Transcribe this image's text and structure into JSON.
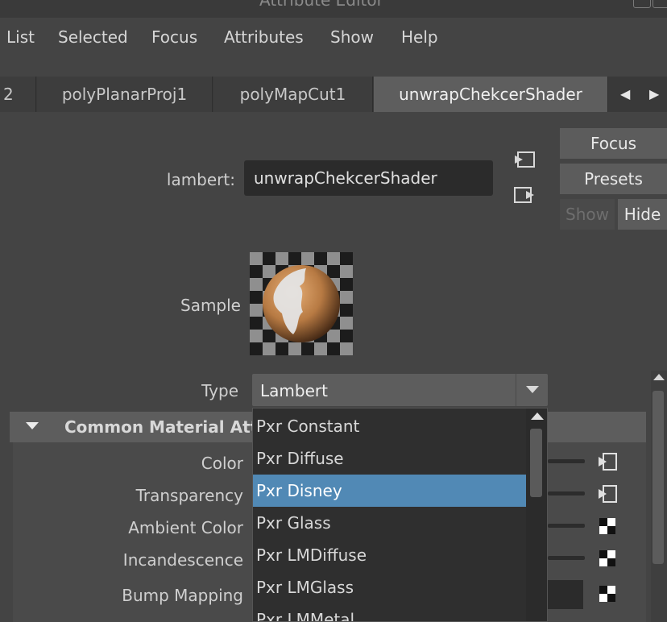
{
  "window": {
    "title_partial": "Attribute Editor"
  },
  "menu": [
    "List",
    "Selected",
    "Focus",
    "Attributes",
    "Show",
    "Help"
  ],
  "tabs": [
    {
      "label": "2",
      "active": false
    },
    {
      "label": "polyPlanarProj1",
      "active": false
    },
    {
      "label": "polyMapCut1",
      "active": false
    },
    {
      "label": "unwrapChekcerShader",
      "active": true
    }
  ],
  "tab_nav": {
    "prev": "◀",
    "next": "▶"
  },
  "side_buttons": {
    "focus": "Focus",
    "presets": "Presets",
    "show": "Show",
    "hide": "Hide"
  },
  "node": {
    "type_label": "lambert:",
    "name": "unwrapChekcerShader"
  },
  "sample": {
    "label": "Sample"
  },
  "type_field": {
    "label": "Type",
    "value": "Lambert"
  },
  "section": {
    "title": "Common Material Attributes"
  },
  "attributes": [
    "Color",
    "Transparency",
    "Ambient Color",
    "Incandescence",
    "Bump Mapping"
  ],
  "dropdown": {
    "items": [
      "Pxr Constant",
      "Pxr Diffuse",
      "Pxr Disney",
      "Pxr Glass",
      "Pxr LMDiffuse",
      "Pxr LMGlass",
      "Pxr LMMetal"
    ],
    "selected": "Pxr Disney"
  },
  "colors": {
    "accent": "#5189b5",
    "background": "#444444"
  }
}
